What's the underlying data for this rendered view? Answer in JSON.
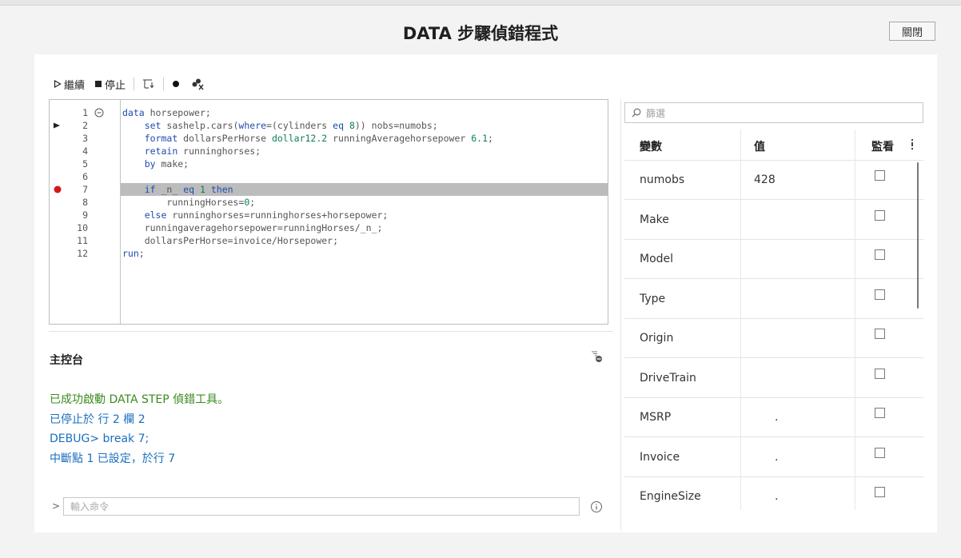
{
  "title": "DATA 步驟偵錯程式",
  "close_label": "關閉",
  "toolbar": {
    "continue_label": "繼續",
    "stop_label": "停止"
  },
  "editor": {
    "breakpoint_color": "#d3181b",
    "current_line": 2,
    "breakpoint_line": 7,
    "highlight_line": 7,
    "lines": [
      {
        "num": "1",
        "code": "data horsepower;"
      },
      {
        "num": "2",
        "code": "    set sashelp.cars(where=(cylinders eq 8)) nobs=numobs;"
      },
      {
        "num": "3",
        "code": "    format dollarsPerHorse dollar12.2 runningAveragehorsepower 6.1;"
      },
      {
        "num": "4",
        "code": "    retain runninghorses;"
      },
      {
        "num": "5",
        "code": "    by make;"
      },
      {
        "num": "6",
        "code": ""
      },
      {
        "num": "7",
        "code": "    if _n_ eq 1 then"
      },
      {
        "num": "8",
        "code": "        runningHorses=0;"
      },
      {
        "num": "9",
        "code": "    else runninghorses=runninghorses+horsepower;"
      },
      {
        "num": "10",
        "code": "    runningaveragehorsepower=runningHorses/_n_;"
      },
      {
        "num": "11",
        "code": "    dollarsPerHorse=invoice/Horsepower;"
      },
      {
        "num": "12",
        "code": "run;"
      }
    ]
  },
  "console": {
    "title": "主控台",
    "messages": [
      {
        "text": "已成功啟動 DATA STEP 偵錯工具。",
        "color": "#3b8b1e"
      },
      {
        "text": "已停止於 行 2 欄 2",
        "color": "#1a6fbf"
      },
      {
        "text": "DEBUG> break 7;",
        "color": "#1a6fbf"
      },
      {
        "text": "中斷點 1 已設定，於行 7",
        "color": "#1a6fbf"
      }
    ],
    "prompt": ">",
    "input_placeholder": "輸入命令",
    "input_value": ""
  },
  "variables": {
    "filter_placeholder": "篩選",
    "headers": {
      "var": "變數",
      "value": "值",
      "watch": "監看"
    },
    "rows": [
      {
        "name": "numobs",
        "value": "428",
        "watch": false
      },
      {
        "name": "Make",
        "value": "",
        "watch": false
      },
      {
        "name": "Model",
        "value": "",
        "watch": false
      },
      {
        "name": "Type",
        "value": "",
        "watch": false
      },
      {
        "name": "Origin",
        "value": "",
        "watch": false
      },
      {
        "name": "DriveTrain",
        "value": "",
        "watch": false
      },
      {
        "name": "MSRP",
        "value": ".",
        "watch": false
      },
      {
        "name": "Invoice",
        "value": ".",
        "watch": false
      },
      {
        "name": "EngineSize",
        "value": ".",
        "watch": false
      }
    ]
  }
}
